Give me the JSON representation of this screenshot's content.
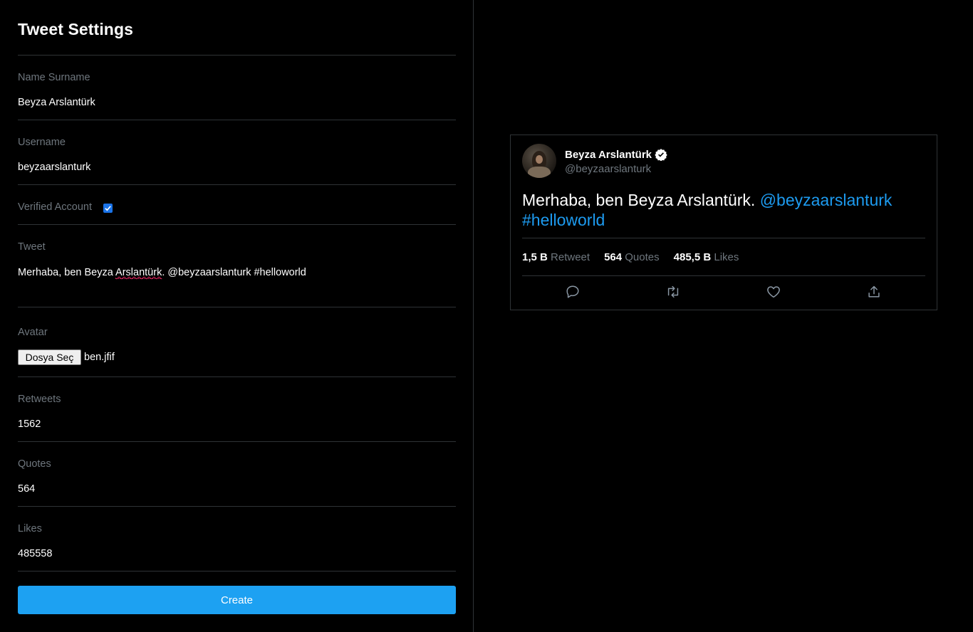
{
  "settings": {
    "title": "Tweet Settings",
    "name_label": "Name Surname",
    "name_value": "Beyza Arslantürk",
    "username_label": "Username",
    "username_value": "beyzaarslanturk",
    "verified_label": "Verified Account",
    "verified_checked": true,
    "tweet_label": "Tweet",
    "tweet_value_before": "Merhaba, ben Beyza ",
    "tweet_value_misspelled": "Arslantürk",
    "tweet_value_after": ". @beyzaarslanturk #helloworld",
    "avatar_label": "Avatar",
    "file_button_label": "Dosya Seç",
    "file_name": "ben.jfif",
    "retweets_label": "Retweets",
    "retweets_value": "1562",
    "quotes_label": "Quotes",
    "quotes_value": "564",
    "likes_label": "Likes",
    "likes_value": "485558",
    "create_label": "Create"
  },
  "tweet": {
    "name": "Beyza Arslantürk",
    "handle": "@beyzaarslanturk",
    "text_plain": "Merhaba, ben Beyza Arslantürk. ",
    "mention": "@beyzaarslanturk",
    "hashtag": "#helloworld",
    "stats": {
      "retweet_count": "1,5 B",
      "retweet_label": "Retweet",
      "quotes_count": "564",
      "quotes_label": "Quotes",
      "likes_count": "485,5 B",
      "likes_label": "Likes"
    }
  },
  "colors": {
    "background": "#000000",
    "accent": "#1da1f2",
    "link": "#1d9bf0",
    "muted": "#6e767d",
    "divider": "#2f3336"
  }
}
